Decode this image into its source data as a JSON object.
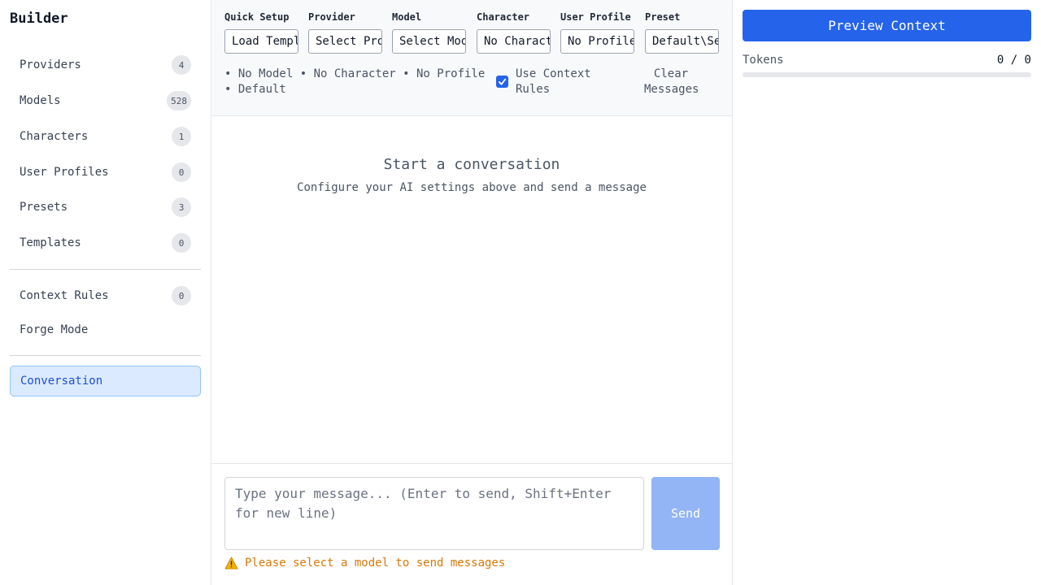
{
  "sidebar": {
    "brand": "Builder",
    "items": [
      {
        "label": "Providers",
        "badge": "4"
      },
      {
        "label": "Models",
        "badge": "528"
      },
      {
        "label": "Characters",
        "badge": "1"
      },
      {
        "label": "User Profiles",
        "badge": "0"
      },
      {
        "label": "Presets",
        "badge": "3"
      },
      {
        "label": "Templates",
        "badge": "0"
      },
      {
        "label": "Context Rules",
        "badge": "0"
      },
      {
        "label": "Forge Mode"
      },
      {
        "label": "Conversation",
        "active": true
      }
    ]
  },
  "toolbar": {
    "fields": [
      {
        "label": "Quick Setup",
        "value": "Load Template"
      },
      {
        "label": "Provider",
        "value": "Select Provider"
      },
      {
        "label": "Model",
        "value": "Select Model"
      },
      {
        "label": "Character",
        "value": "No Character"
      },
      {
        "label": "User Profile",
        "value": "No Profile"
      },
      {
        "label": "Preset",
        "value": "Default\\Se"
      }
    ],
    "status": "• No Model • No Character • No Profile • Default",
    "use_context_rules": "Use Context Rules",
    "use_context_rules_checked": true,
    "clear_messages": "Clear Messages"
  },
  "empty_state": {
    "title": "Start a conversation",
    "subtitle": "Configure your AI settings above and send a message"
  },
  "composer": {
    "placeholder": "Type your message... (Enter to send, Shift+Enter for new line)",
    "send_label": "Send",
    "warning_icon": "warning-icon",
    "warning": "Please select a model to send messages"
  },
  "right_panel": {
    "preview_button": "Preview Context",
    "tokens_label": "Tokens",
    "tokens_value": "0 / 0",
    "tokens_fraction": 0
  },
  "colors": {
    "accent": "#2563eb",
    "send_disabled": "#93b4f5",
    "warning": "#d97706",
    "active_nav_bg": "#dbeafe"
  }
}
